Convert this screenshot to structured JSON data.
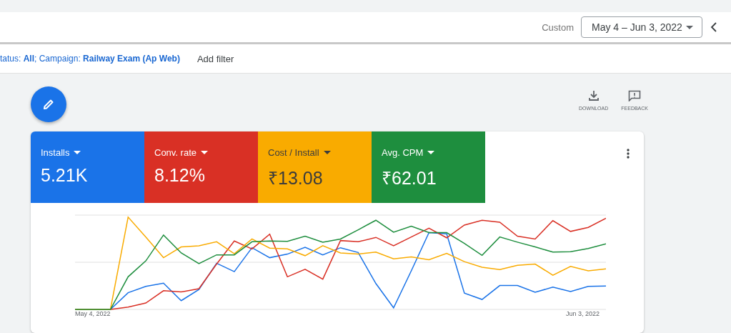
{
  "date_range": {
    "label": "Custom",
    "value": "May 4 – Jun 3, 2022"
  },
  "filters": {
    "text": "tatus: **All**; Campaign: **Railway Exam (Ap Web)**",
    "add_filter": "Add filter"
  },
  "actions": [
    {
      "kind": "download",
      "label": "DOWNLOAD"
    },
    {
      "kind": "feedback",
      "label": "FEEDBACK"
    }
  ],
  "metrics": [
    {
      "label": "Installs",
      "value": "5.21K",
      "color": "#1a73e8"
    },
    {
      "label": "Conv. rate",
      "value": "8.12%",
      "color": "#d93025"
    },
    {
      "label": "Cost / Install",
      "value": "₹13.08",
      "color": "#f9ab00"
    },
    {
      "label": "Avg. CPM",
      "value": "₹62.01",
      "color": "#1e8e3e"
    }
  ],
  "chart": {
    "x_start": "May 4, 2022",
    "x_end": "Jun 3, 2022"
  }
}
